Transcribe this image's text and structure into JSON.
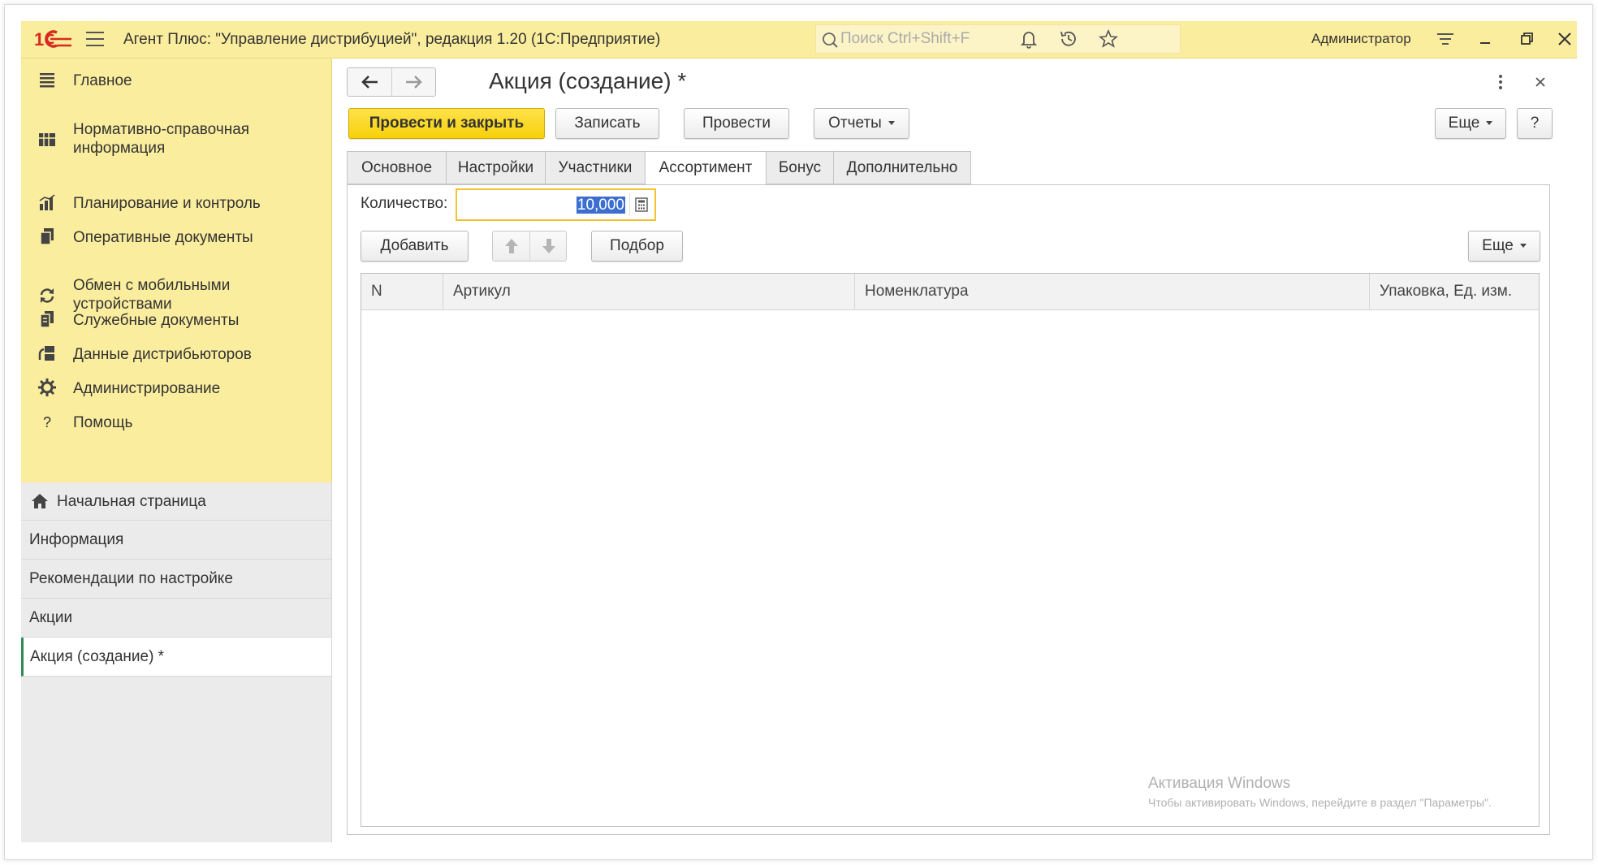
{
  "app": {
    "title": "Агент Плюс: \"Управление дистрибуцией\", редакция 1.20  (1С:Предприятие)",
    "logo_text": "1С",
    "search_placeholder": "Поиск Ctrl+Shift+F",
    "user": "Администратор",
    "accent": "#fbed9e",
    "primary_button_color": "#f7d10a"
  },
  "sidebar": {
    "items": [
      {
        "label": "Главное",
        "icon": "menu-list-icon"
      },
      {
        "label": "Нормативно-справочная информация",
        "icon": "grid-book-icon"
      },
      {
        "label": "Планирование и контроль",
        "icon": "bar-chart-icon"
      },
      {
        "label": "Оперативные документы",
        "icon": "documents-icon"
      },
      {
        "label": "Обмен с мобильными устройствами",
        "icon": "sync-icon"
      },
      {
        "label": "Служебные документы",
        "icon": "service-docs-icon"
      },
      {
        "label": "Данные дистрибьюторов",
        "icon": "distributor-icon"
      },
      {
        "label": "Администрирование",
        "icon": "gear-icon"
      },
      {
        "label": "Помощь",
        "icon": "question-icon"
      }
    ]
  },
  "open_windows": {
    "home": "Начальная страница",
    "items": [
      "Информация",
      "Рекомендации по настройке",
      "Акции",
      "Акция (создание) *"
    ]
  },
  "form": {
    "title": "Акция (создание) *",
    "buttons": {
      "post_close": "Провести и закрыть",
      "save": "Записать",
      "post": "Провести",
      "reports": "Отчеты",
      "more": "Еще",
      "help": "?"
    },
    "tabs": [
      "Основное",
      "Настройки",
      "Участники",
      "Ассортимент",
      "Бонус",
      "Дополнительно"
    ],
    "active_tab": "Ассортимент"
  },
  "assortment": {
    "quantity_label": "Количество:",
    "quantity_value": "10,000",
    "add": "Добавить",
    "select": "Подбор",
    "more": "Еще",
    "columns": [
      "N",
      "Артикул",
      "Номенклатура",
      "Упаковка, Ед. изм."
    ]
  },
  "watermark": {
    "line1": "Активация Windows",
    "line2": "Чтобы активировать Windows, перейдите в раздел \"Параметры\"."
  }
}
